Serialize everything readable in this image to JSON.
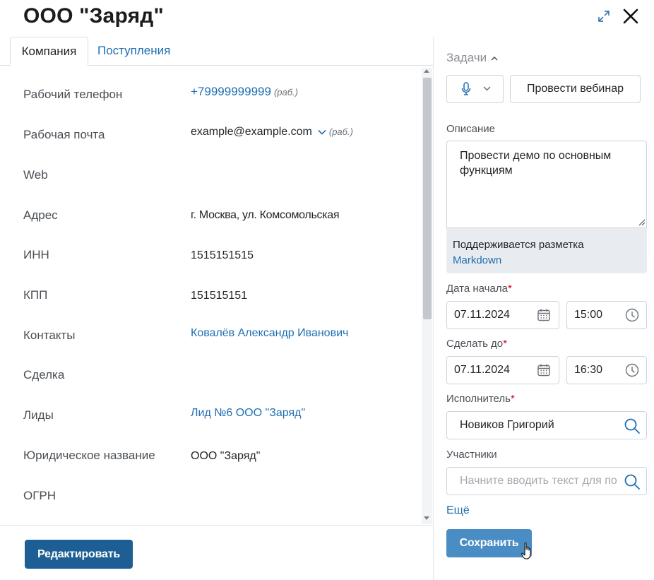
{
  "window": {
    "title": "ООО \"Заряд\""
  },
  "tabs": [
    {
      "label": "Компания",
      "active": true
    },
    {
      "label": "Поступления",
      "active": false
    }
  ],
  "fields": [
    {
      "label": "Рабочий телефон",
      "value": "+79999999999",
      "tag": "(раб.)"
    },
    {
      "label": "Рабочая почта",
      "value": "example@example.com",
      "tag": "(раб.)"
    },
    {
      "label": "Web",
      "value": ""
    },
    {
      "label": "Адрес",
      "value": "г. Москва, ул. Комсомольская"
    },
    {
      "label": "ИНН",
      "value": "1515151515"
    },
    {
      "label": "КПП",
      "value": "151515151"
    },
    {
      "label": "Контакты",
      "value": "Ковалёв Александр Иванович"
    },
    {
      "label": "Сделка",
      "value": ""
    },
    {
      "label": "Лиды",
      "value": "Лид №6 ООО \"Заряд\""
    },
    {
      "label": "Юридическое название",
      "value": "ООО \"Заряд\""
    },
    {
      "label": "ОГРН",
      "value": ""
    }
  ],
  "footer": {
    "edit_label": "Редактировать"
  },
  "task_panel": {
    "heading": "Задачи",
    "webinar_button": "Провести вебинар",
    "description_label": "Описание",
    "description_value": "Провести демо по основным функциям",
    "markdown_note": "Поддерживается разметка",
    "markdown_link": "Markdown",
    "start_label": "Дата начала",
    "start_date": "07.11.2024",
    "start_time": "15:00",
    "due_label": "Сделать до",
    "due_date": "07.11.2024",
    "due_time": "16:30",
    "assignee_label": "Исполнитель",
    "assignee_value": "Новиков Григорий",
    "participants_label": "Участники",
    "participants_placeholder": "Начните вводить текст для по",
    "required_mark": "*",
    "more_link": "Ещё",
    "save_label": "Сохранить"
  },
  "colors": {
    "link": "#1f6fb2",
    "primary_button": "#1d5f94",
    "save_button": "#4a8cc4",
    "required": "#d0021b"
  }
}
